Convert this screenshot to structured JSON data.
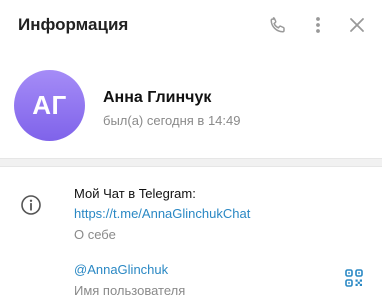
{
  "header": {
    "title": "Информация",
    "icons": [
      "phone-icon",
      "more-vertical-icon",
      "close-icon"
    ]
  },
  "profile": {
    "avatar_initials": "АГ",
    "name": "Анна Глинчук",
    "status": "был(а) сегодня в 14:49"
  },
  "info": {
    "bio_text": "Мой Чат в Telegram:",
    "bio_link": "https://t.me/AnnaGlinchukChat",
    "bio_caption": "О себе",
    "username": "@AnnaGlinchuk",
    "username_caption": "Имя пользователя"
  },
  "colors": {
    "avatar_gradient_top": "#a58cf7",
    "avatar_gradient_bottom": "#7f63ea",
    "link": "#2a88c4",
    "secondary_text": "#8a8a8a",
    "icon": "#999999"
  }
}
